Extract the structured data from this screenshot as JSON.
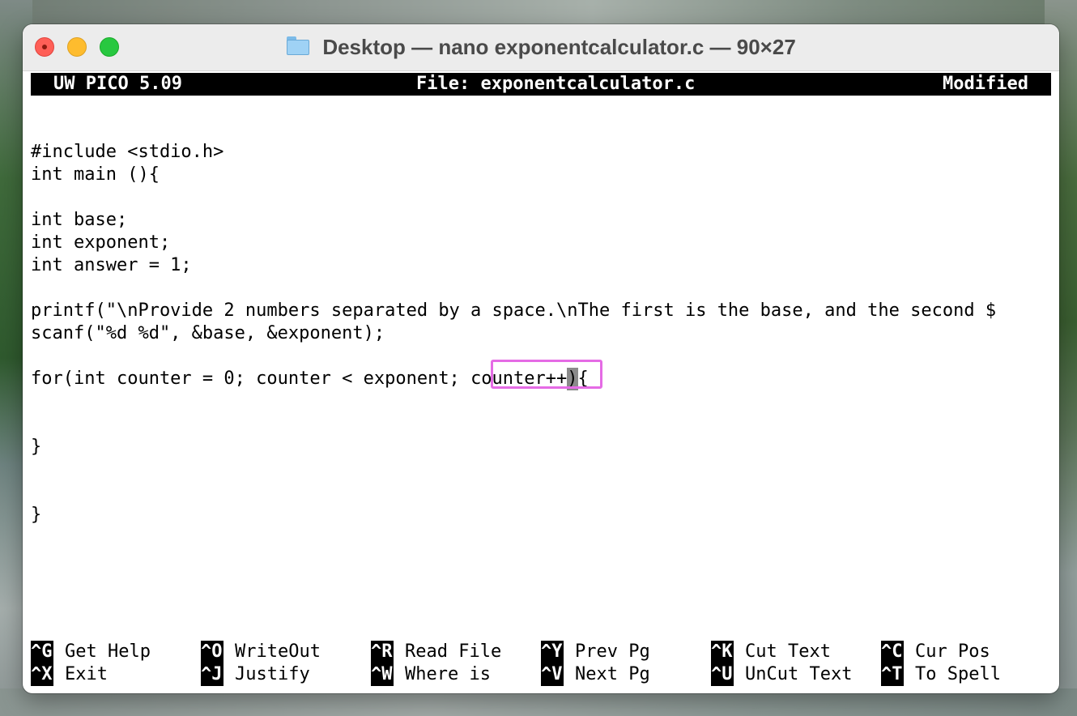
{
  "window": {
    "title": "Desktop — nano exponentcalculator.c — 90×27"
  },
  "header": {
    "app": "UW PICO 5.09",
    "file": "File: exponentcalculator.c",
    "status": "Modified"
  },
  "code": {
    "lines": [
      "#include <stdio.h>",
      "int main (){",
      "",
      "int base;",
      "int exponent;",
      "int answer = 1;",
      "",
      "printf(\"\\nProvide 2 numbers separated by a space.\\nThe first is the base, and the second $",
      "scanf(\"%d %d\", &base, &exponent);",
      "",
      "for(int counter = 0; counter < exponent; ",
      "",
      "",
      "}",
      "",
      "",
      "}"
    ],
    "for_highlight": "counter++",
    "for_cursor_char": ")",
    "for_tail": "{"
  },
  "shortcuts": {
    "row1": [
      {
        "key": "^G",
        "label": "Get Help"
      },
      {
        "key": "^O",
        "label": "WriteOut"
      },
      {
        "key": "^R",
        "label": "Read File"
      },
      {
        "key": "^Y",
        "label": "Prev Pg"
      },
      {
        "key": "^K",
        "label": "Cut Text"
      },
      {
        "key": "^C",
        "label": "Cur Pos"
      }
    ],
    "row2": [
      {
        "key": "^X",
        "label": "Exit"
      },
      {
        "key": "^J",
        "label": "Justify"
      },
      {
        "key": "^W",
        "label": "Where is"
      },
      {
        "key": "^V",
        "label": "Next Pg"
      },
      {
        "key": "^U",
        "label": "UnCut Text"
      },
      {
        "key": "^T",
        "label": "To Spell"
      }
    ]
  },
  "colors": {
    "highlight_box": "#e56be5",
    "cursor": "#8a8a8a"
  }
}
